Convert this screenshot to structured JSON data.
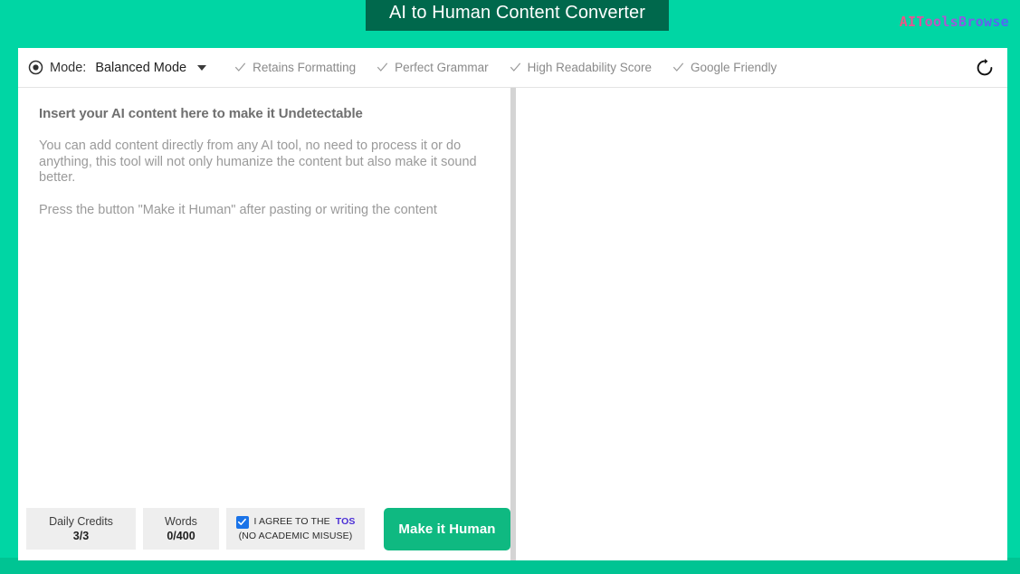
{
  "header": {
    "title": "AI to Human Content Converter",
    "brand": "AIToolsBrowse",
    "title_bg_color": "#00684C",
    "page_bg_color": "#00D6A4"
  },
  "toolbar": {
    "mode_icon": "radio-selected-icon",
    "mode_label": "Mode:",
    "mode_value": "Balanced Mode",
    "caret_icon": "chevron-down-icon",
    "features": [
      {
        "icon": "check-icon",
        "label": "Retains Formatting"
      },
      {
        "icon": "check-icon",
        "label": "Perfect Grammar"
      },
      {
        "icon": "check-icon",
        "label": "High Readability Score"
      },
      {
        "icon": "check-icon",
        "label": "Google Friendly"
      }
    ],
    "reset_icon": "refresh-icon"
  },
  "editor": {
    "placeholder_heading": "Insert your AI content here to make it Undetectable",
    "placeholder_paragraph": "You can add content directly from any AI tool, no need to process it or do anything, this tool will not only humanize the content but also make it sound better.",
    "placeholder_hint": "Press the button \"Make it Human\" after pasting or writing the content",
    "value": ""
  },
  "output": {
    "value": ""
  },
  "footer": {
    "credits_label": "Daily Credits",
    "credits_value": "3/3",
    "words_label": "Words",
    "words_value": "0/400",
    "tos_prefix": "I AGREE TO THE",
    "tos_link": "TOS",
    "tos_note": "(NO ACADEMIC MISUSE)",
    "tos_checked": true,
    "submit_label": "Make it Human",
    "submit_color": "#0FB981"
  }
}
